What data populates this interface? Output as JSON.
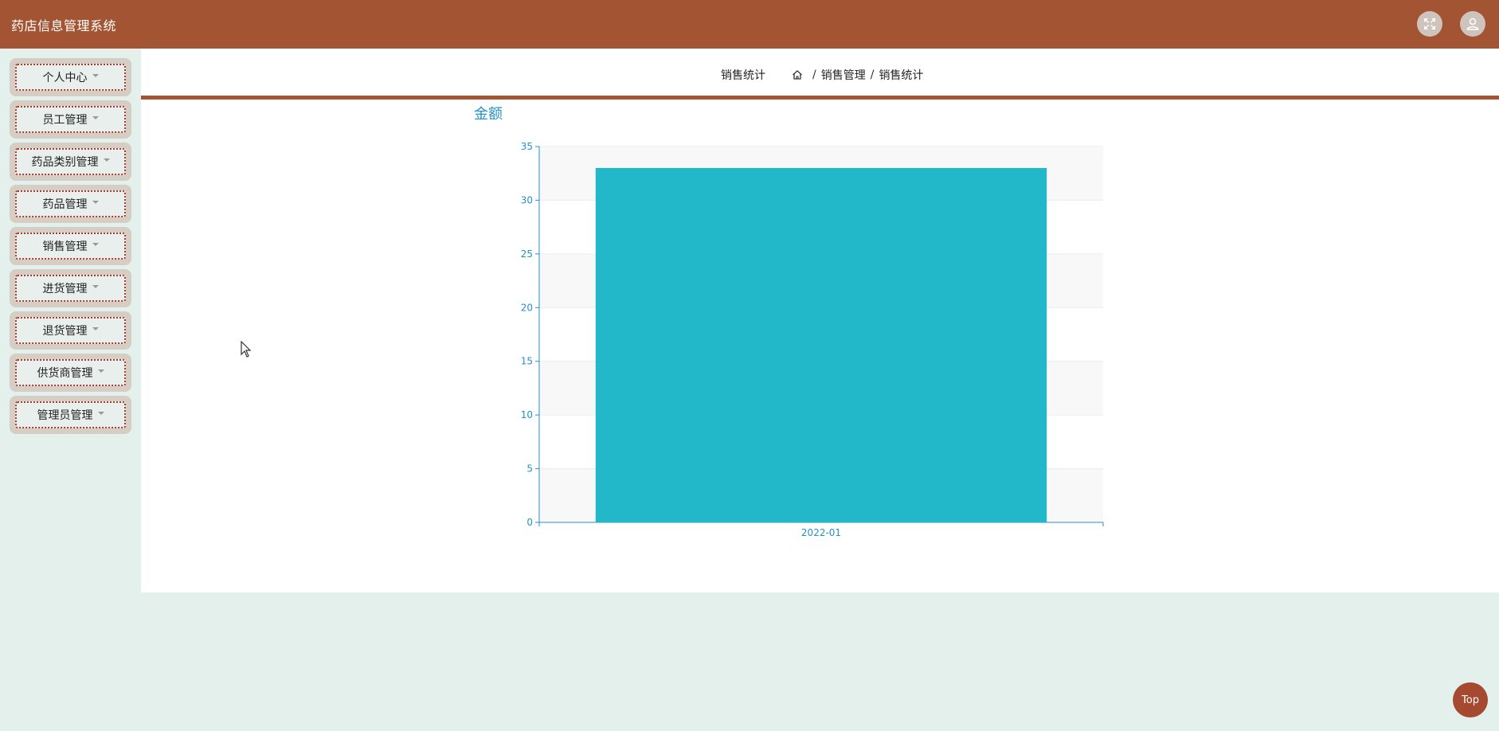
{
  "app": {
    "title": "药店信息管理系统"
  },
  "topbar": {
    "fullscreen_icon": "fullscreen-icon",
    "user_icon": "user-icon"
  },
  "sidebar": {
    "items": [
      {
        "label": "个人中心"
      },
      {
        "label": "员工管理"
      },
      {
        "label": "药品类别管理"
      },
      {
        "label": "药品管理"
      },
      {
        "label": "销售管理"
      },
      {
        "label": "进货管理"
      },
      {
        "label": "退货管理"
      },
      {
        "label": "供货商管理"
      },
      {
        "label": "管理员管理"
      }
    ]
  },
  "header": {
    "title": "销售统计",
    "breadcrumb": [
      "销售管理",
      "销售统计"
    ],
    "separator": "/"
  },
  "colors": {
    "brand": "#a35432",
    "bar": "#22b7c9",
    "axis": "#2591c9"
  },
  "chart_data": {
    "type": "bar",
    "title": "金额",
    "categories": [
      "2022-01"
    ],
    "values": [
      33
    ],
    "ylim": [
      0,
      35
    ],
    "yticks": [
      0,
      5,
      10,
      15,
      20,
      25,
      30,
      35
    ],
    "grid": true,
    "xlabel": "",
    "ylabel": ""
  },
  "back_to_top": {
    "label": "Top"
  }
}
